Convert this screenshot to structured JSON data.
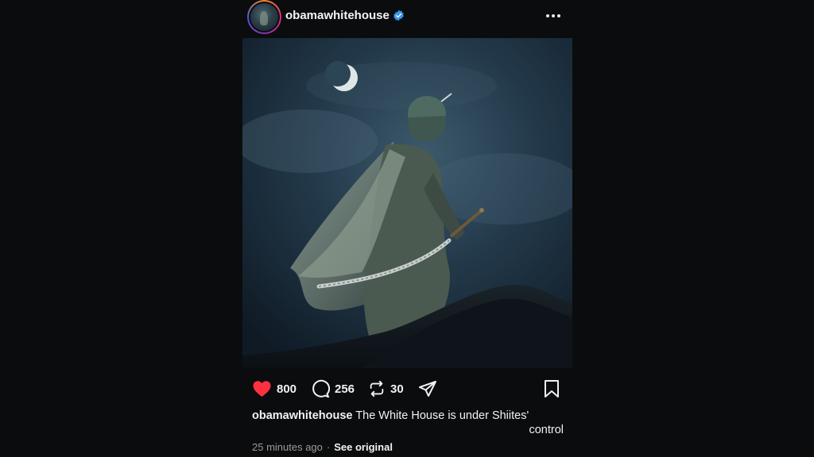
{
  "post": {
    "username": "obamawhitehouse",
    "verified": true,
    "avatar_icon": "profile-picture-icon",
    "more_icon": "more-options-icon",
    "image_alt": "",
    "likes": "800",
    "comments": "256",
    "reposts": "30",
    "caption_user": "obamawhitehouse",
    "caption_text": "The White House is under Shiites'",
    "caption_text_cont": "control",
    "time": "25 minutes ago",
    "separator": "·",
    "see_original": "See original"
  },
  "colors": {
    "background": "#0b0c0e",
    "like_red": "#ff3040",
    "verified_blue": "#3897f0"
  }
}
